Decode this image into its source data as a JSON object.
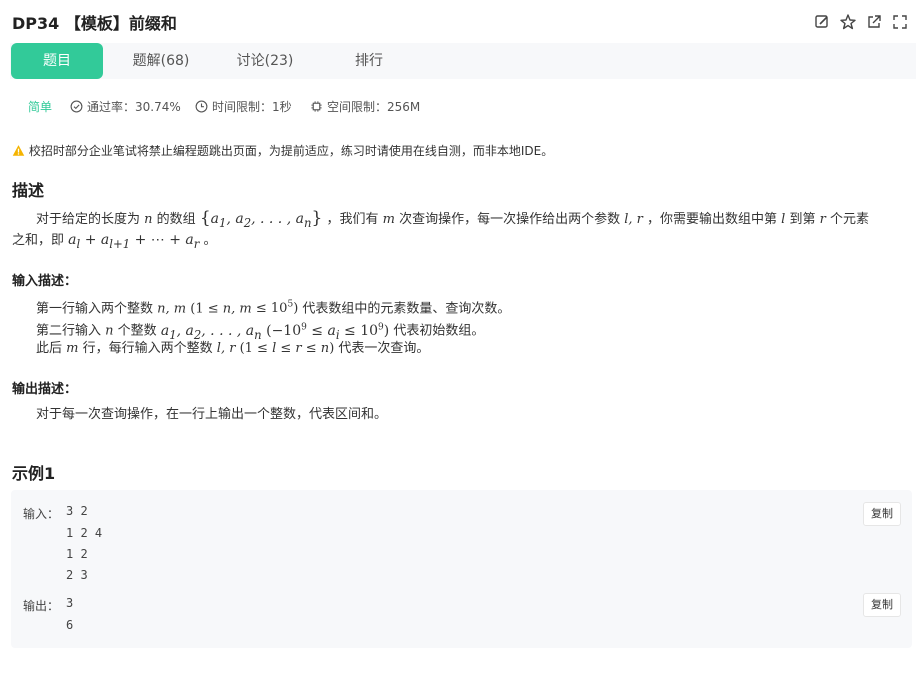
{
  "header": {
    "title": "DP34 【模板】前缀和",
    "icons": [
      "edit-icon",
      "star-icon",
      "share-icon",
      "expand-icon"
    ]
  },
  "tabs": [
    {
      "label": "题目",
      "active": true
    },
    {
      "label": "题解(68)",
      "active": false
    },
    {
      "label": "讨论(23)",
      "active": false
    },
    {
      "label": "排行",
      "active": false
    }
  ],
  "info": {
    "difficulty": "简单",
    "pass_rate": "通过率：30.74%",
    "time_limit": "时间限制：1秒",
    "space_limit": "空间限制：256M"
  },
  "warning": "校招时部分企业笔试将禁止编程题跳出页面，为提前适应，练习时请使用在线自测，而非本地IDE。",
  "description": {
    "heading": "描述",
    "line1_a": "对于给定的长度为",
    "line1_b": "的数组",
    "line1_c": "，我们有",
    "line1_d": "次查询操作，每一次操作给出两个参数",
    "line1_e": "，你需要输出数组中第",
    "line1_f": "到第",
    "line1_g": "个元素",
    "line2_a": "之和，即",
    "line2_b": "。"
  },
  "input_desc": {
    "heading": "输入描述：",
    "line1_a": "第一行输入两个整数",
    "line1_b": "代表数组中的元素数量、查询次数。",
    "line2_a": "第二行输入",
    "line2_b": "个整数",
    "line2_c": "代表初始数组。",
    "line3_a": "此后",
    "line3_b": "行，每行输入两个整数",
    "line3_c": "代表一次查询。"
  },
  "output_desc": {
    "heading": "输出描述：",
    "text": "对于每一次查询操作，在一行上输出一个整数，代表区间和。"
  },
  "example": {
    "heading": "示例1",
    "input_label": "输入：",
    "input_lines": [
      "3 2",
      "1 2 4",
      "1 2",
      "2 3"
    ],
    "output_label": "输出：",
    "output_lines": [
      "3",
      "6"
    ],
    "copy_label": "复制"
  },
  "colors": {
    "accent": "#32ca99",
    "tab_bg": "#f7f8fa",
    "warning": "#f5b400"
  }
}
